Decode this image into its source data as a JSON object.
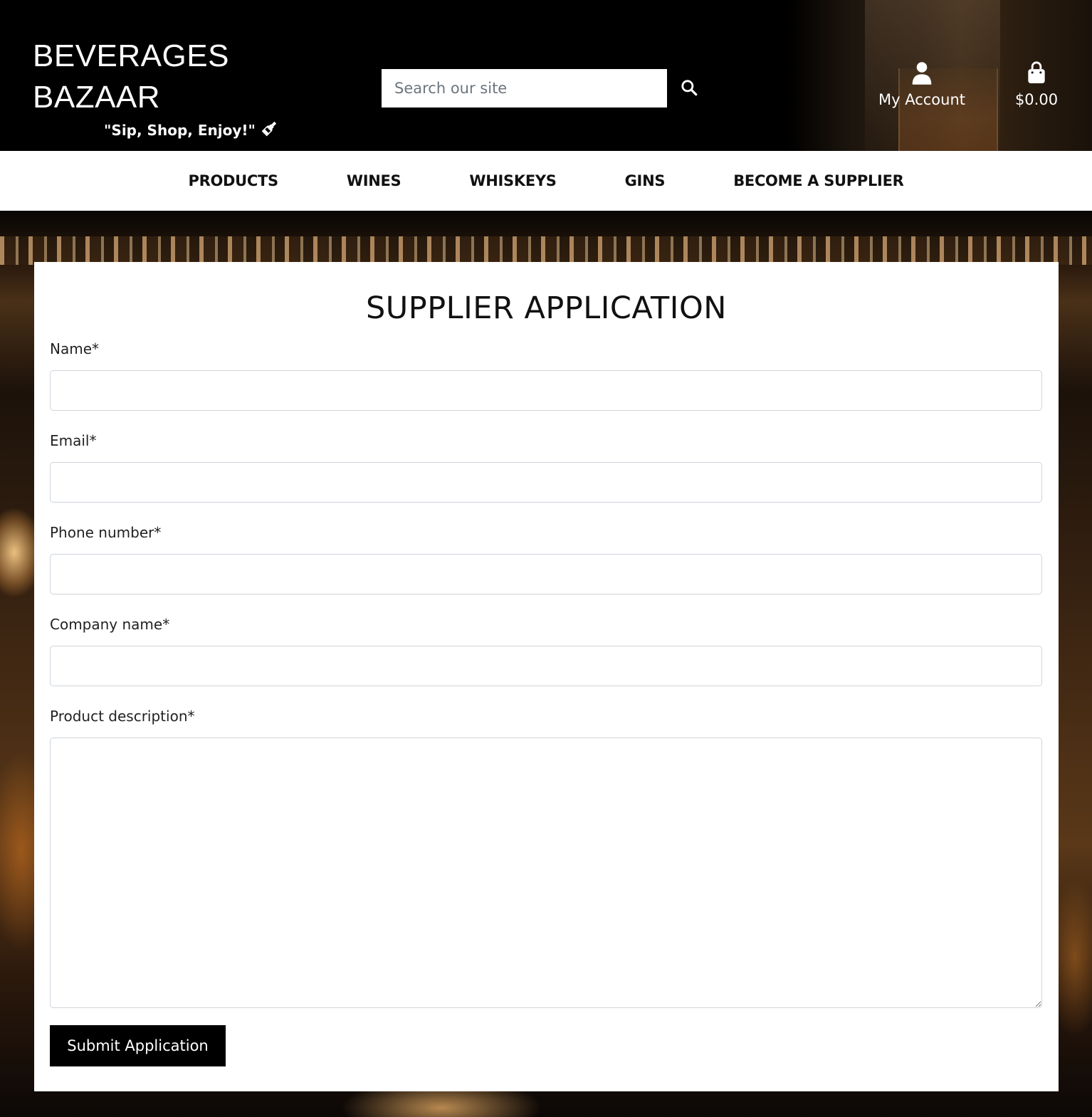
{
  "header": {
    "brand_line1": "BEVERAGES",
    "brand_line2": "BAZAAR",
    "tagline": "\"Sip, Shop, Enjoy!\"",
    "tagline_icon": "wine-bottle-icon",
    "search": {
      "placeholder": "Search our site",
      "icon": "search-icon"
    },
    "account": {
      "label": "My Account",
      "icon": "user-icon"
    },
    "bag": {
      "label": "$0.00",
      "icon": "shopping-bag-icon"
    }
  },
  "nav": {
    "items": [
      {
        "label": "PRODUCTS"
      },
      {
        "label": "WINES"
      },
      {
        "label": "WHISKEYS"
      },
      {
        "label": "GINS"
      },
      {
        "label": "BECOME A SUPPLIER"
      }
    ]
  },
  "form": {
    "title": "SUPPLIER APPLICATION",
    "fields": [
      {
        "label": "Name*",
        "value": ""
      },
      {
        "label": "Email*",
        "value": ""
      },
      {
        "label": "Phone number*",
        "value": ""
      },
      {
        "label": "Company name*",
        "value": ""
      },
      {
        "label": "Product description*",
        "value": ""
      }
    ],
    "submit_label": "Submit Application"
  }
}
